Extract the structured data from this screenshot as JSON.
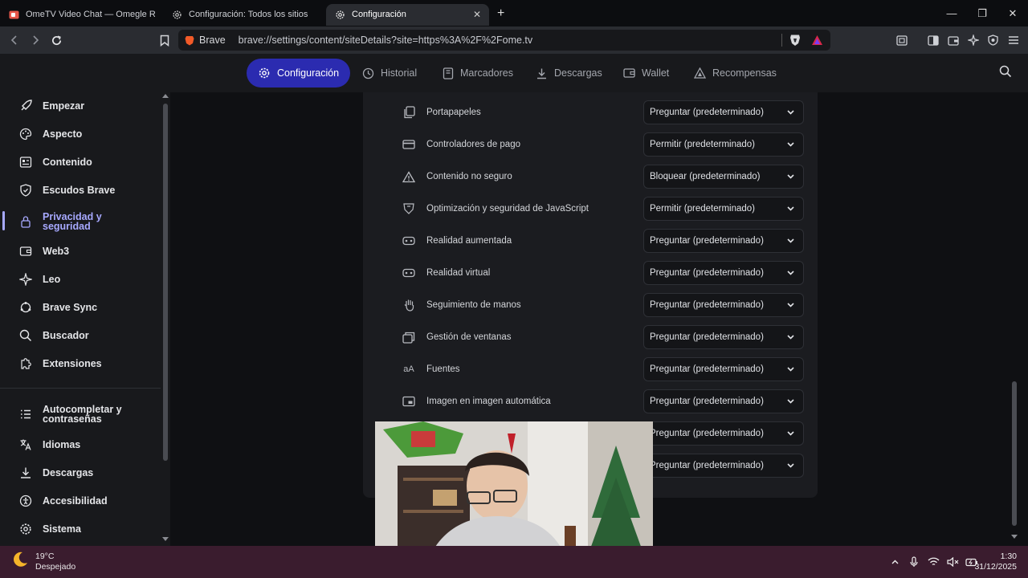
{
  "browser": {
    "tabs": [
      {
        "title": "OmeTV Video Chat — Omegle Rand",
        "icon": "video-icon",
        "active": false
      },
      {
        "title": "Configuración: Todos los sitios",
        "icon": "gear-icon",
        "active": false
      },
      {
        "title": "Configuración",
        "icon": "gear-icon",
        "active": true
      }
    ],
    "new_tab": "+",
    "brand_label": "Brave",
    "url": "brave://settings/content/siteDetails?site=https%3A%2F%2Fome.tv"
  },
  "settings_nav": {
    "items": [
      {
        "label": "Configuración",
        "icon": "gear-icon",
        "active": true
      },
      {
        "label": "Historial",
        "icon": "history-icon",
        "active": false
      },
      {
        "label": "Marcadores",
        "icon": "bookmarks-icon",
        "active": false
      },
      {
        "label": "Descargas",
        "icon": "download-icon",
        "active": false
      },
      {
        "label": "Wallet",
        "icon": "wallet-icon",
        "active": false
      },
      {
        "label": "Recompensas",
        "icon": "rewards-icon",
        "active": false
      }
    ]
  },
  "sidebar": {
    "items": [
      {
        "label": "Empezar",
        "icon": "rocket-icon"
      },
      {
        "label": "Aspecto",
        "icon": "palette-icon"
      },
      {
        "label": "Contenido",
        "icon": "content-icon"
      },
      {
        "label": "Escudos Brave",
        "icon": "shield-icon"
      },
      {
        "label": "Privacidad y\nseguridad",
        "icon": "lock-icon",
        "active": true
      },
      {
        "label": "Web3",
        "icon": "wallet-icon"
      },
      {
        "label": "Leo",
        "icon": "sparkle-icon"
      },
      {
        "label": "Brave Sync",
        "icon": "sync-icon"
      },
      {
        "label": "Buscador",
        "icon": "search-icon"
      },
      {
        "label": "Extensiones",
        "icon": "puzzle-icon"
      },
      {
        "label": "Autocompletar y\ncontraseñas",
        "icon": "list-icon"
      },
      {
        "label": "Idiomas",
        "icon": "translate-icon"
      },
      {
        "label": "Descargas",
        "icon": "download-icon"
      },
      {
        "label": "Accesibilidad",
        "icon": "accessibility-icon"
      },
      {
        "label": "Sistema",
        "icon": "gear-icon"
      }
    ]
  },
  "permissions": [
    {
      "label": "Portapapeles",
      "icon": "clipboard-icon",
      "value": "Preguntar (predeterminado)"
    },
    {
      "label": "Controladores de pago",
      "icon": "card-icon",
      "value": "Permitir (predeterminado)"
    },
    {
      "label": "Contenido no seguro",
      "icon": "warning-icon",
      "value": "Bloquear (predeterminado)"
    },
    {
      "label": "Optimización y seguridad de JavaScript",
      "icon": "js-icon",
      "value": "Permitir (predeterminado)"
    },
    {
      "label": "Realidad aumentada",
      "icon": "ar-icon",
      "value": "Preguntar (predeterminado)"
    },
    {
      "label": "Realidad virtual",
      "icon": "vr-icon",
      "value": "Preguntar (predeterminado)"
    },
    {
      "label": "Seguimiento de manos",
      "icon": "hand-icon",
      "value": "Preguntar (predeterminado)"
    },
    {
      "label": "Gestión de ventanas",
      "icon": "windows-icon",
      "value": "Preguntar (predeterminado)"
    },
    {
      "label": "Fuentes",
      "icon": "font-icon",
      "value": "Preguntar (predeterminado)"
    },
    {
      "label": "Imagen en imagen automática",
      "icon": "pip-icon",
      "value": "Preguntar (predeterminado)"
    },
    {
      "label": "",
      "icon": "",
      "value": "Preguntar (predeterminado)"
    },
    {
      "label": "",
      "icon": "",
      "value": "Preguntar (predeterminado)"
    }
  ],
  "taskbar": {
    "weather_temp": "19°C",
    "weather_desc": "Despejado",
    "time": "1:30",
    "date": "31/12/2025"
  },
  "colors": {
    "accent": "#2b2bb0",
    "active_sidebar": "#a7a9ff",
    "taskbar": "#3a1c2e"
  }
}
